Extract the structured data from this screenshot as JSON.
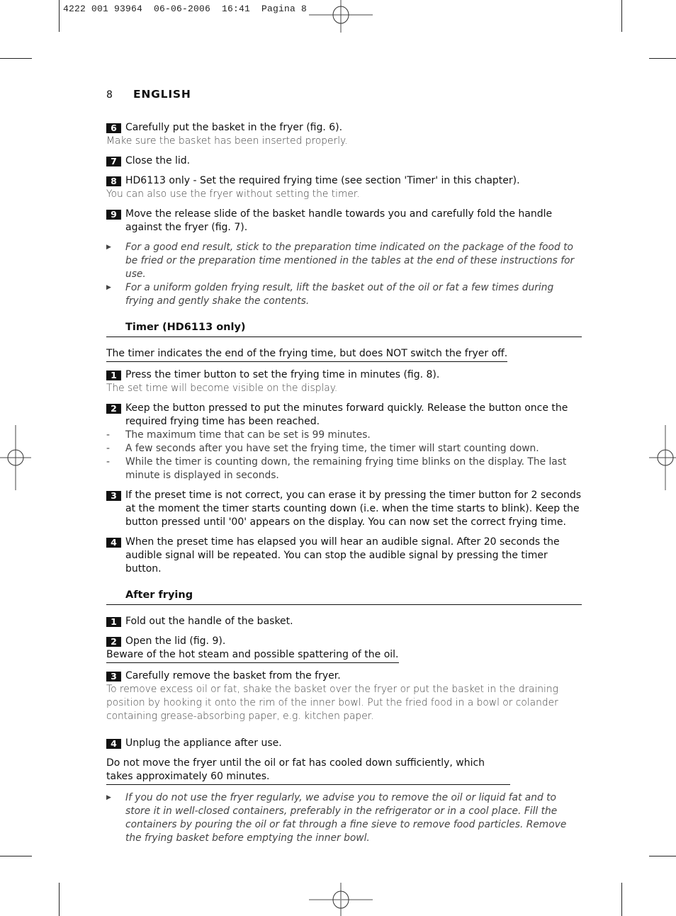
{
  "slug": "4222 001 93964  06-06-2006  16:41  Pagina 8",
  "header": {
    "page_number": "8",
    "language": "ENGLISH"
  },
  "intro_steps": [
    {
      "num": "6",
      "text": "Carefully put the basket in the fryer (fig. 6).",
      "note": "Make sure the basket has been inserted properly."
    },
    {
      "num": "7",
      "text": "Close the lid."
    },
    {
      "num": "8",
      "text": "HD6113 only - Set the required frying time (see section 'Timer' in this chapter).",
      "note": "You can also use the fryer without setting the timer."
    },
    {
      "num": "9",
      "text": "Move the release slide of the basket handle towards you and carefully fold the handle against the fryer (fig. 7)."
    }
  ],
  "intro_tips": [
    "For a good end result, stick to the preparation time indicated on the package of the food to be fried or the preparation time mentioned in the tables at the end of these instructions for use.",
    "For a uniform golden frying result, lift the basket out of the oil or fat a few times during frying and gently shake the contents."
  ],
  "timer_section": {
    "title": "Timer (HD6113 only)",
    "warning": "The timer indicates the end of the frying time, but does NOT switch the fryer off.",
    "steps": [
      {
        "num": "1",
        "text": "Press the timer button to set the frying time in minutes (fig. 8).",
        "note": "The set time will become visible on the display."
      },
      {
        "num": "2",
        "text": "Keep the button pressed to put the minutes forward quickly. Release the button once the required frying time has been reached.",
        "dashes": [
          "The maximum time that can be set is 99 minutes.",
          "A few seconds after you have set the frying time, the timer will start counting down.",
          "While the timer is counting down, the remaining frying time blinks on the display. The last minute is displayed in seconds."
        ]
      },
      {
        "num": "3",
        "text": "If the preset time is not correct, you can erase it by pressing the timer button for 2 seconds at the moment the timer starts counting down (i.e. when the time starts to blink). Keep the button pressed until '00' appears on the display. You can now set the correct frying time."
      },
      {
        "num": "4",
        "text": "When the preset time has elapsed you will hear an audible signal. After 20 seconds the audible signal will be repeated. You can stop the audible signal by pressing the timer button."
      }
    ]
  },
  "after_section": {
    "title": "After frying",
    "steps": [
      {
        "num": "1",
        "text": "Fold out the handle of the basket."
      },
      {
        "num": "2",
        "text": "Open the lid (fig. 9).",
        "warning": "Beware of the hot steam and possible spattering of the oil."
      },
      {
        "num": "3",
        "text": "Carefully remove the basket from the fryer.",
        "note": "To remove excess oil or fat, shake the basket over the fryer or put the basket in the draining position by hooking it onto the rim of the inner bowl. Put the fried food in a bowl or colander containing grease-absorbing paper, e.g. kitchen paper."
      },
      {
        "num": "4",
        "text": "Unplug the appliance after use."
      }
    ],
    "warning": "Do not move the fryer until the oil or fat has cooled down sufficiently, which takes approximately 60 minutes.",
    "tip": "If you do not use the fryer regularly, we advise you to remove the oil or liquid fat and to store it in well-closed containers, preferably in the refrigerator or in a cool place. Fill the containers by pouring the oil or fat through a fine sieve to remove food particles. Remove the frying basket before emptying the inner bowl."
  }
}
